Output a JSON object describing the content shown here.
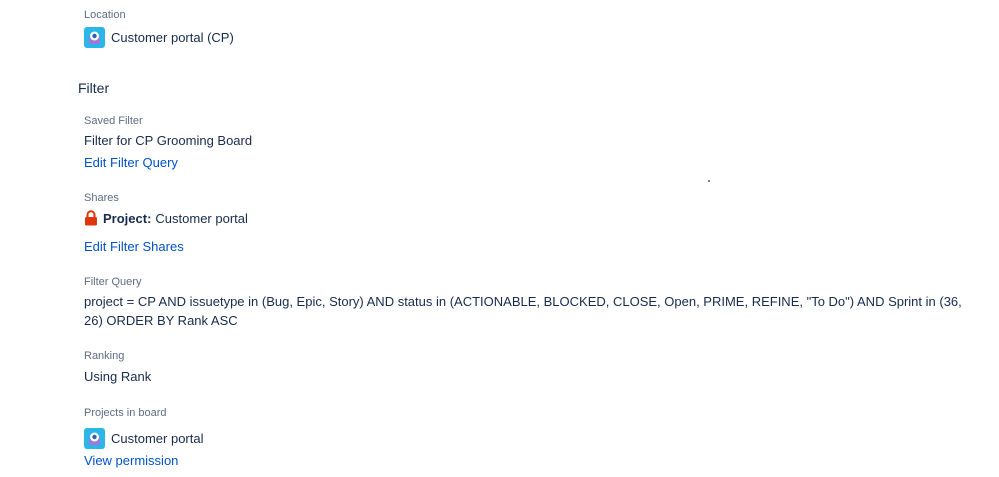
{
  "location": {
    "label": "Location",
    "project_name": "Customer portal (CP)"
  },
  "filter_section": {
    "title": "Filter"
  },
  "saved_filter": {
    "label": "Saved Filter",
    "value": "Filter for CP Grooming Board",
    "edit_link": "Edit Filter Query"
  },
  "shares": {
    "label": "Shares",
    "type_label": "Project:",
    "value": "Customer portal",
    "edit_link": "Edit Filter Shares"
  },
  "filter_query": {
    "label": "Filter Query",
    "value": "project = CP AND issuetype in (Bug, Epic, Story) AND status in (ACTIONABLE, BLOCKED, CLOSE, Open, PRIME, REFINE, \"To Do\") AND Sprint in (36, 26) ORDER BY Rank ASC"
  },
  "ranking": {
    "label": "Ranking",
    "value": "Using Rank"
  },
  "projects_in_board": {
    "label": "Projects in board",
    "project_name": "Customer portal",
    "link": "View permission"
  },
  "colors": {
    "link": "#0052cc",
    "label": "#5e6c84",
    "text": "#172b4d",
    "project_icon_bg": "#2ab7e8",
    "lock": "#de350b"
  },
  "icons": {
    "project": "project-avatar-icon",
    "lock": "lock-icon"
  }
}
